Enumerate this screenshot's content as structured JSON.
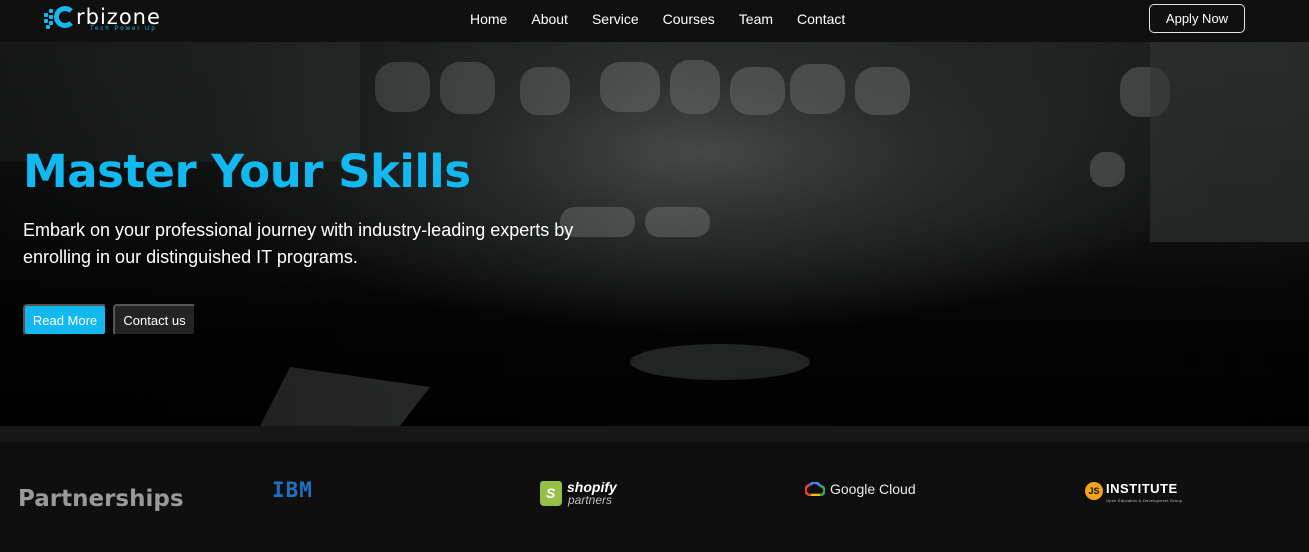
{
  "brand": {
    "name": "rbizone",
    "tagline": "Tech Power Up"
  },
  "nav": {
    "items": [
      {
        "label": "Home"
      },
      {
        "label": "About"
      },
      {
        "label": "Service"
      },
      {
        "label": "Courses"
      },
      {
        "label": "Team"
      },
      {
        "label": "Contact"
      }
    ],
    "cta": "Apply Now"
  },
  "hero": {
    "title": "Master Your Skills",
    "description": "Embark on your professional journey with industry-leading experts by enrolling in our distinguished IT programs.",
    "primary_button": "Read More",
    "secondary_button": "Contact us"
  },
  "partners": {
    "title": "Partnerships",
    "logos": {
      "ibm": "IBM",
      "shopify_main": "shopify",
      "shopify_sub": "partners",
      "google_cloud": "Google Cloud",
      "js_badge": "JS",
      "js_institute": "INSTITUTE",
      "js_sub": "Open Education & Development Group"
    }
  },
  "colors": {
    "accent": "#12b8f0",
    "shopify_green": "#95bf47",
    "ibm_blue": "#1f70c1",
    "js_orange": "#f5a31a"
  }
}
